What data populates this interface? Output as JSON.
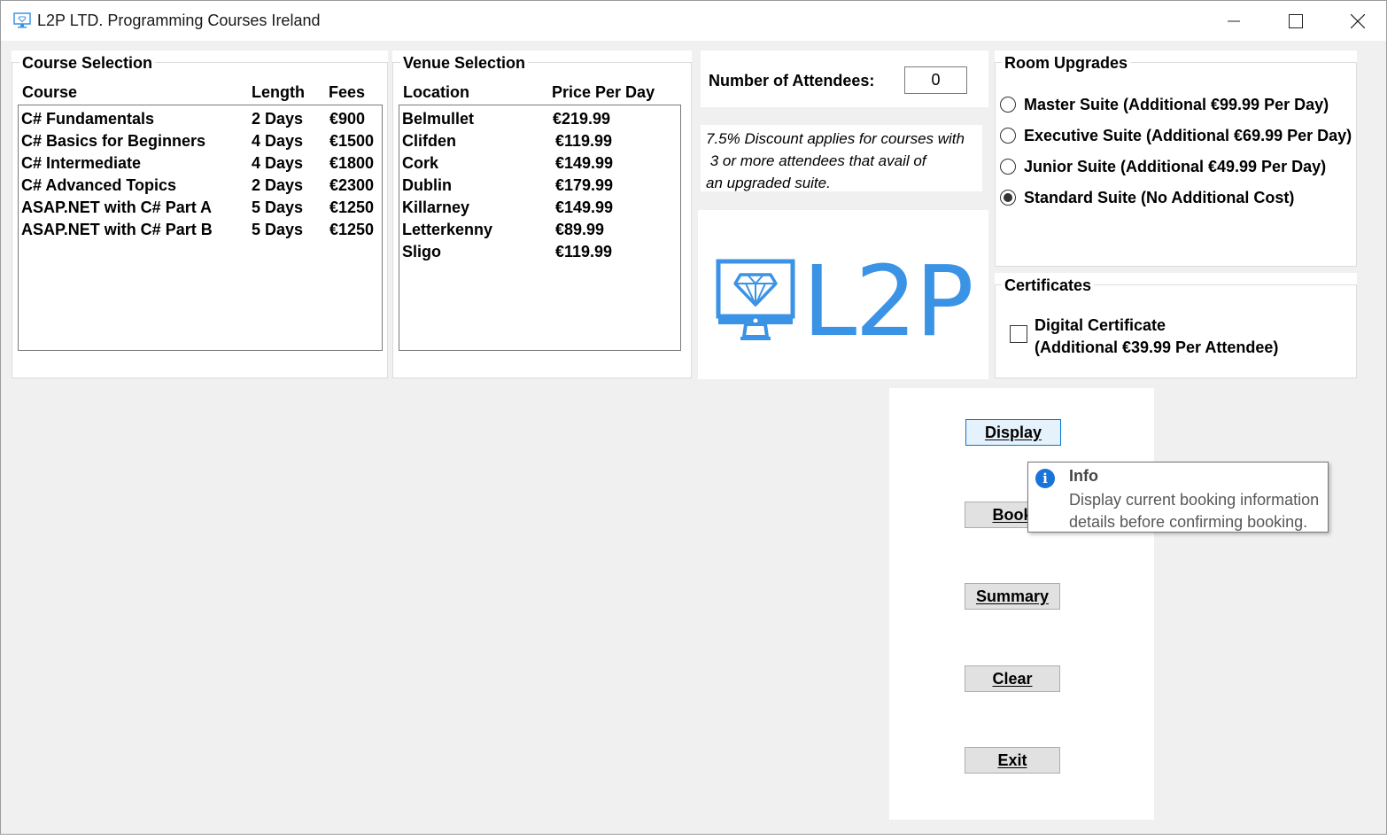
{
  "window": {
    "title": "L2P LTD. Programming Courses Ireland"
  },
  "course_selection": {
    "title": "Course Selection",
    "columns": [
      "Course",
      "Length",
      "Fees"
    ],
    "rows": [
      [
        "C# Fundamentals",
        "2 Days",
        "€900"
      ],
      [
        "C# Basics for Beginners",
        "4 Days",
        "€1500"
      ],
      [
        "C# Intermediate",
        "4 Days",
        "€1800"
      ],
      [
        "C# Advanced Topics",
        "2 Days",
        "€2300"
      ],
      [
        "ASAP.NET with C# Part A",
        "5 Days",
        "€1250"
      ],
      [
        "ASAP.NET with C# Part B",
        "5 Days",
        "€1250"
      ]
    ]
  },
  "venue_selection": {
    "title": "Venue Selection",
    "columns": [
      "Location",
      "Price Per Day"
    ],
    "rows": [
      [
        "Belmullet",
        "€219.99"
      ],
      [
        "Clifden",
        "€119.99"
      ],
      [
        "Cork",
        "€149.99"
      ],
      [
        "Dublin",
        "€179.99"
      ],
      [
        "Killarney",
        "€149.99"
      ],
      [
        "Letterkenny",
        "€89.99"
      ],
      [
        "Sligo",
        "€119.99"
      ]
    ]
  },
  "attendees": {
    "label": "Number of Attendees:",
    "value": "0"
  },
  "discount_note": {
    "line1": "7.5% Discount applies for courses with",
    "line2": " 3 or more attendees that avail of",
    "line3": "an upgraded suite."
  },
  "logo": {
    "text": "L2P",
    "color": "#3b93e6"
  },
  "room_upgrades": {
    "title": "Room Upgrades",
    "options": [
      {
        "label": "Master Suite (Additional €99.99 Per Day)",
        "checked": false
      },
      {
        "label": "Executive Suite (Additional €69.99 Per Day)",
        "checked": false
      },
      {
        "label": "Junior Suite (Additional €49.99 Per Day)",
        "checked": false
      },
      {
        "label": "Standard Suite (No Additional Cost)",
        "checked": true
      }
    ]
  },
  "certificates": {
    "title": "Certificates",
    "line1": "Digital Certificate",
    "line2": "(Additional €39.99 Per Attendee)",
    "checked": false
  },
  "buttons": {
    "display": "Display",
    "book": "Book",
    "summary": "Summary",
    "clear": "Clear",
    "exit": "Exit"
  },
  "tooltip": {
    "title": "Info",
    "line1": "Display current booking information",
    "line2": "details before confirming booking."
  }
}
